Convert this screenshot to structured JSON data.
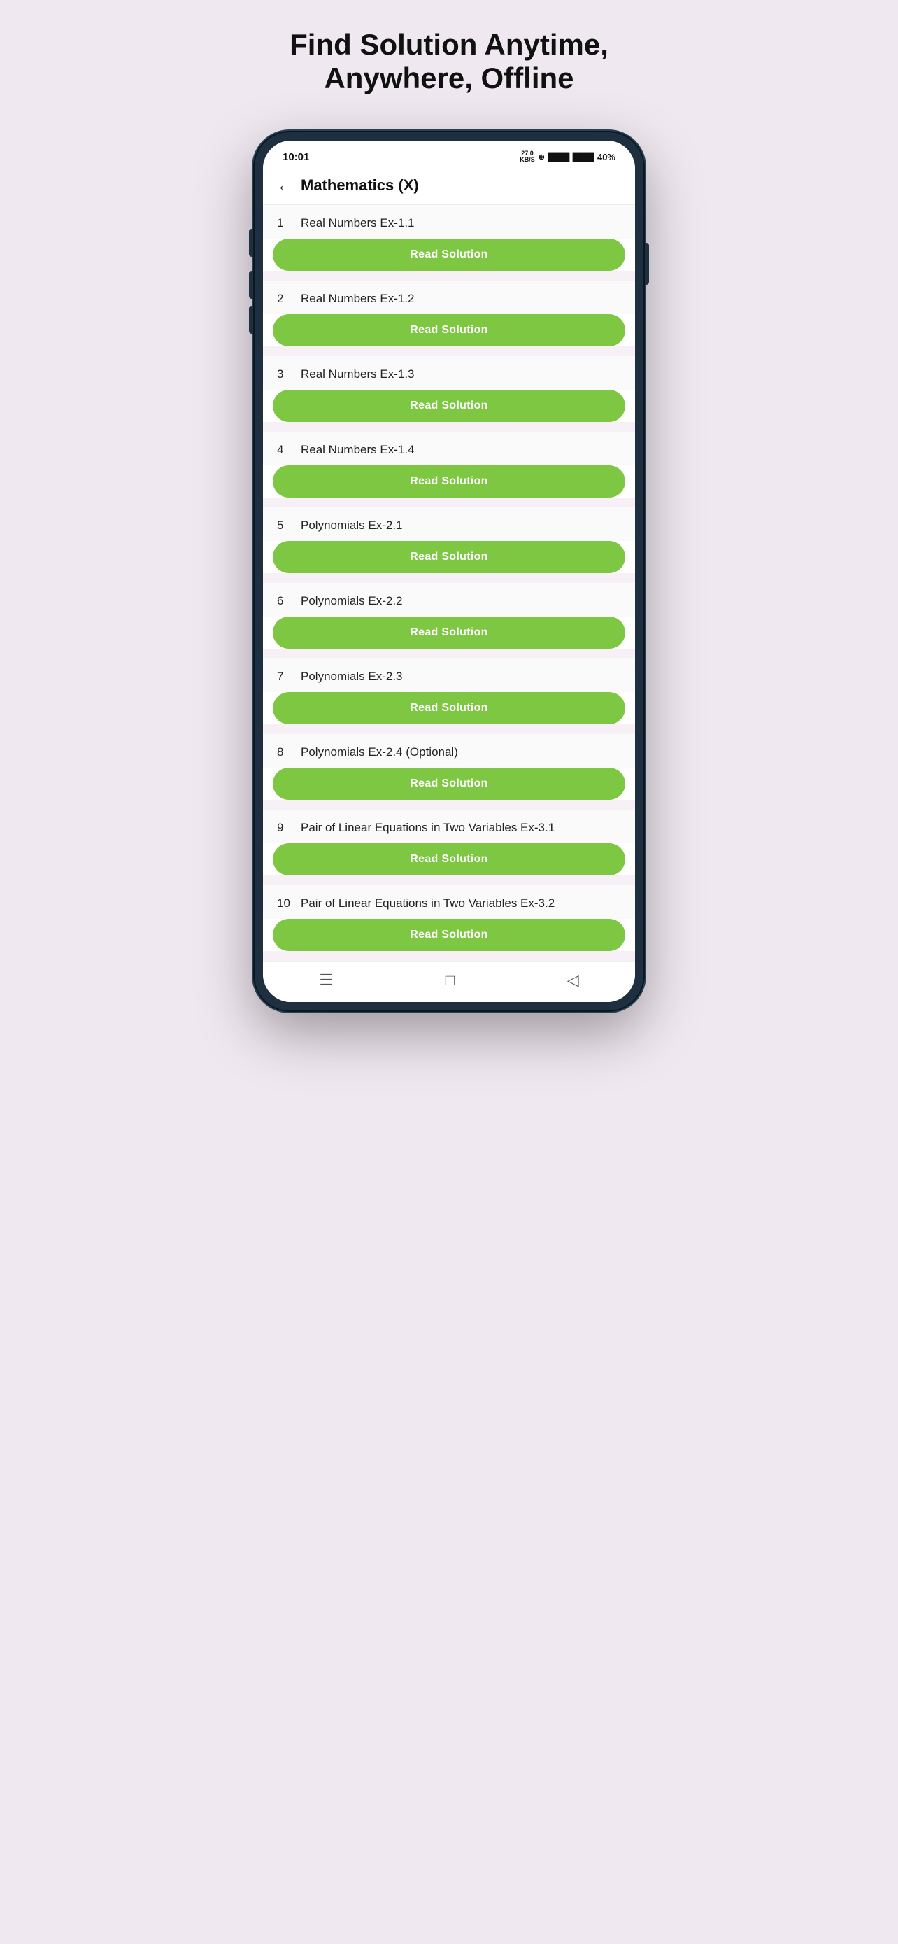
{
  "page": {
    "title_line1": "Find Solution Anytime,",
    "title_line2": "Anywhere, Offline"
  },
  "statusBar": {
    "time": "10:01",
    "kb": "27.0\nKB/S",
    "wifi": "wifi",
    "signal1": "▌▌▌",
    "signal2": "▌▌▌",
    "battery": "40%"
  },
  "topBar": {
    "back_icon": "←",
    "title": "Mathematics (X)"
  },
  "readSolutionLabel": "Read Solution",
  "items": [
    {
      "number": "1",
      "label": "Real Numbers Ex-1.1"
    },
    {
      "number": "2",
      "label": "Real Numbers Ex-1.2"
    },
    {
      "number": "3",
      "label": "Real Numbers Ex-1.3"
    },
    {
      "number": "4",
      "label": "Real Numbers Ex-1.4"
    },
    {
      "number": "5",
      "label": "Polynomials Ex-2.1"
    },
    {
      "number": "6",
      "label": "Polynomials Ex-2.2"
    },
    {
      "number": "7",
      "label": "Polynomials Ex-2.3"
    },
    {
      "number": "8",
      "label": "Polynomials Ex-2.4 (Optional)"
    },
    {
      "number": "9",
      "label": "Pair of Linear Equations in Two Variables Ex-3.1"
    },
    {
      "number": "10",
      "label": "Pair of Linear Equations in Two Variables Ex-3.2"
    }
  ],
  "bottomNav": {
    "menu_icon": "☰",
    "home_icon": "□",
    "back_icon": "◁"
  },
  "colors": {
    "green_button": "#7dc742",
    "background": "#f0e8f0",
    "phone_shell": "#1e3040"
  }
}
